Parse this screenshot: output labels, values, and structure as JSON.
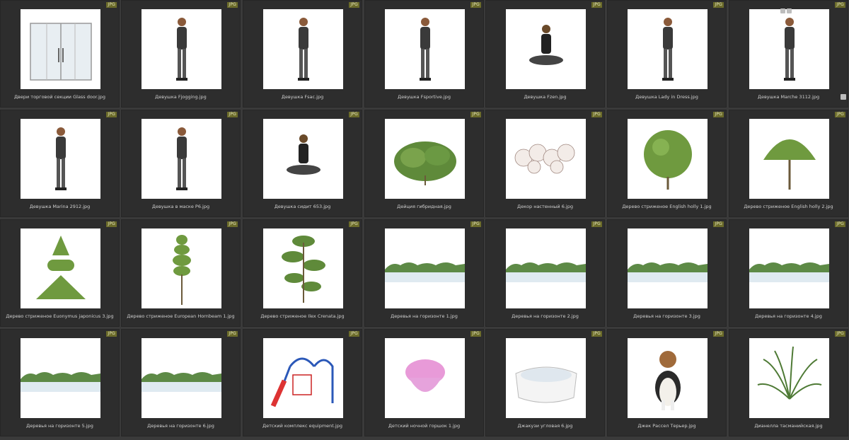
{
  "badge_label": "JPG",
  "items": [
    {
      "filename": "Двери торговой секции Glass door.jpg",
      "thumb": "door-icon"
    },
    {
      "filename": "Девушка Fjogging.jpg",
      "thumb": "person-icon"
    },
    {
      "filename": "Девушка Fsac.jpg",
      "thumb": "person-icon"
    },
    {
      "filename": "Девушка Fsportive.jpg",
      "thumb": "person-icon"
    },
    {
      "filename": "Девушка Fzen.jpg",
      "thumb": "person-sitting-icon"
    },
    {
      "filename": "Девушка Lady in Dress.jpg",
      "thumb": "person-icon"
    },
    {
      "filename": "Девушка Marche 3112.jpg",
      "thumb": "person-icon"
    },
    {
      "filename": "Девушка Marina 2912.jpg",
      "thumb": "person-icon"
    },
    {
      "filename": "Девушка в маске P6.jpg",
      "thumb": "person-icon"
    },
    {
      "filename": "Девушка сидит 653.jpg",
      "thumb": "person-sitting-icon"
    },
    {
      "filename": "Дейция гибридная.jpg",
      "thumb": "shrub-icon"
    },
    {
      "filename": "Декор настенный 6.jpg",
      "thumb": "decor-icon"
    },
    {
      "filename": "Дерево стриженое English holly 1.jpg",
      "thumb": "round-tree-icon"
    },
    {
      "filename": "Дерево стриженое English holly 2.jpg",
      "thumb": "dome-tree-icon"
    },
    {
      "filename": "Дерево стриженое Euonymus japonicus 3.jpg",
      "thumb": "cone-tree-icon"
    },
    {
      "filename": "Дерево стриженое European Hornbeam 1.jpg",
      "thumb": "spiral-tree-icon"
    },
    {
      "filename": "Дерево стриженое Ilex Crenata.jpg",
      "thumb": "bonsai-tree-icon"
    },
    {
      "filename": "Деревья на горизонте 1.jpg",
      "thumb": "horizon-icon"
    },
    {
      "filename": "Деревья на горизонте 2.jpg",
      "thumb": "horizon-icon"
    },
    {
      "filename": "Деревья на горизонте 3.jpg",
      "thumb": "horizon-icon"
    },
    {
      "filename": "Деревья на горизонте 4.jpg",
      "thumb": "horizon-icon"
    },
    {
      "filename": "Деревья на горизонте 5.jpg",
      "thumb": "horizon-icon"
    },
    {
      "filename": "Деревья на горизонте 6.jpg",
      "thumb": "horizon-icon"
    },
    {
      "filename": "Детский комплекс equipment.jpg",
      "thumb": "playground-icon"
    },
    {
      "filename": "Детский ночной горшок 1.jpg",
      "thumb": "potty-icon"
    },
    {
      "filename": "Джакузи угловая 6.jpg",
      "thumb": "jacuzzi-icon"
    },
    {
      "filename": "Джек Рассел Терьер.jpg",
      "thumb": "dog-icon"
    },
    {
      "filename": "Дианелла тасманийская.jpg",
      "thumb": "grass-plant-icon"
    }
  ]
}
